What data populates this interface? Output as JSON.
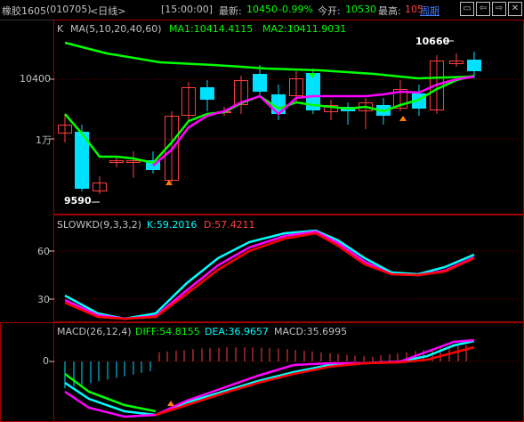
{
  "header": {
    "name": "橡胶1605",
    "code": "(010705)",
    "period": "<日线>",
    "time": "[15:00:00]",
    "latest_label": "最新:",
    "latest_value": "10450",
    "change": "-0.99%",
    "open_label": "今开:",
    "open_value": "10530",
    "high_label": "最高:",
    "high_value": "105",
    "period_link": "周期"
  },
  "panel1": {
    "title": "K",
    "ma_label": "MA(5,10,20,40,60)",
    "ma1": "MA1:10414.4115",
    "ma2": "MA2:10411.9031",
    "y_labels": [
      "10400",
      "1万"
    ],
    "high_mark": "10660",
    "low_mark": "9590"
  },
  "panel2": {
    "title": "SLOWKD(9,3,3,2)",
    "k": "K:59.2016",
    "d": "D:57.4211",
    "y_labels": [
      "60",
      "30"
    ]
  },
  "panel3": {
    "title": "MACD(26,12,4)",
    "diff": "DIFF:54.8155",
    "dea": "DEA:36.9657",
    "macd": "MACD:35.6995",
    "y_labels": [
      "0"
    ]
  },
  "colors": {
    "up": "#ff4040",
    "down": "#00e0ff",
    "ma_green": "#00ff00",
    "ma_magenta": "#ff00ff",
    "kd_k": "#00ffff",
    "kd_d": "#ff0000",
    "grid": "#800000"
  }
}
